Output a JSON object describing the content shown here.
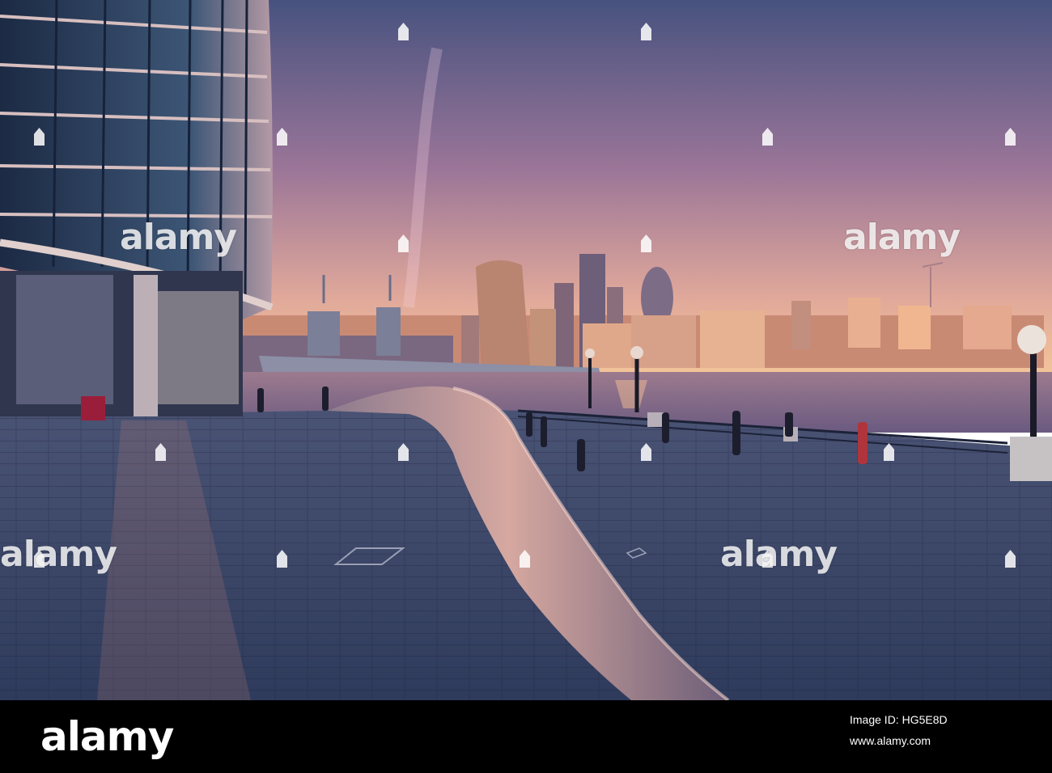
{
  "watermark": {
    "text": "alamy"
  },
  "footer": {
    "logo": "alamy",
    "image_id_label": "Image ID: HG5E8D",
    "url": "www.alamy.com"
  },
  "palette": {
    "sky_top": "#4a5582",
    "sky_mid": "#b17a9a",
    "sky_horizon": "#f0b898",
    "river": "#8a6c86",
    "promenade": "#3d4a6a",
    "railing": "#c49a9a",
    "footer_bg": "#000000"
  }
}
